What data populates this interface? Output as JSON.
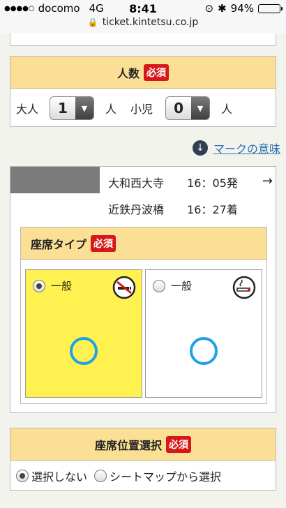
{
  "statusbar": {
    "carrier": "docomo",
    "network": "4G",
    "time": "8:41",
    "battery": "94%",
    "battery_level": 0.94
  },
  "browser": {
    "url": "ticket.kintetsu.co.jp"
  },
  "people": {
    "title": "人数",
    "required": "必須",
    "adult_label": "大人",
    "adult_value": "1",
    "adult_unit": "人",
    "child_label": "小児",
    "child_value": "0",
    "child_unit": "人"
  },
  "legend_link": "マークの意味",
  "train": {
    "departure_station": "大和西大寺",
    "departure_time": "16：05発",
    "arrival_station": "近鉄丹波橋",
    "arrival_time": "16：27着",
    "arrow": "→"
  },
  "seat_type": {
    "title": "座席タイプ",
    "required": "必須",
    "options": [
      {
        "label": "一般",
        "selected": true,
        "icon": "no-smoking-icon"
      },
      {
        "label": "一般",
        "selected": false,
        "icon": "smoking-icon"
      }
    ]
  },
  "seat_position": {
    "title": "座席位置選択",
    "required": "必須",
    "options": [
      {
        "label": "選択しない",
        "selected": true
      },
      {
        "label": "シートマップから選択",
        "selected": false
      }
    ]
  },
  "colors": {
    "header_bg": "#fbdf95",
    "required_bg": "#d81818",
    "selected_bg": "#fff14f",
    "seat_ring": "#1ea1e8",
    "link": "#2b6fb4"
  }
}
